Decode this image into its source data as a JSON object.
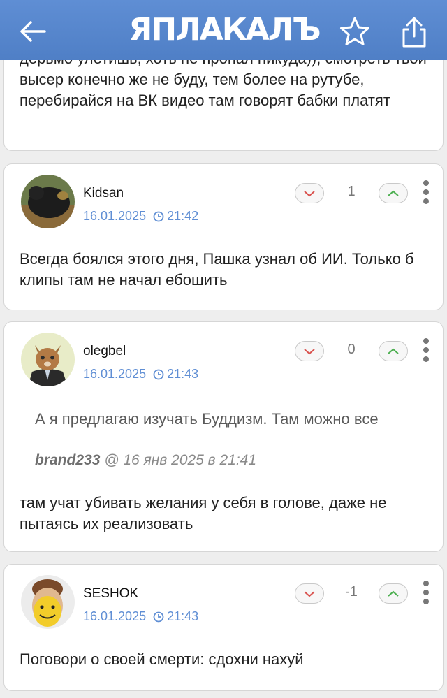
{
  "header": {
    "logo_text": "ЯПЛАКАЛЪ",
    "back_icon": "back-arrow-icon",
    "favorite_icon": "star-icon",
    "share_icon": "share-icon"
  },
  "colors": {
    "header_bg": "#5f8ed4",
    "date_text": "#5f8ed4",
    "down_arrow": "#d9534f",
    "up_arrow": "#4caf50"
  },
  "comments": [
    {
      "text": "дерьмо улетишь, хоть не пропал никуда)), смотреть твой высер конечно же не буду, тем более на рутубе, перебирайся на ВК видео там говорят бабки платят"
    },
    {
      "username": "Kidsan",
      "date": "16.01.2025",
      "time": "21:42",
      "score": "1",
      "text": "Всегда боялся этого дня, Пашка узнал об ИИ. Только б клипы там не начал ебошить"
    },
    {
      "username": "olegbel",
      "date": "16.01.2025",
      "time": "21:43",
      "score": "0",
      "quote": {
        "text": "А я предлагаю изучать Буддизм. Там можно все",
        "author": "brand233",
        "meta": "@ 16 янв 2025 в 21:41"
      },
      "text": "там учат убивать желания у себя в голове, даже не пытаясь их реализовать"
    },
    {
      "username": "SESHOK",
      "date": "16.01.2025",
      "time": "21:43",
      "score": "-1",
      "text": "Поговори о своей смерти: сдохни нахуй"
    }
  ]
}
